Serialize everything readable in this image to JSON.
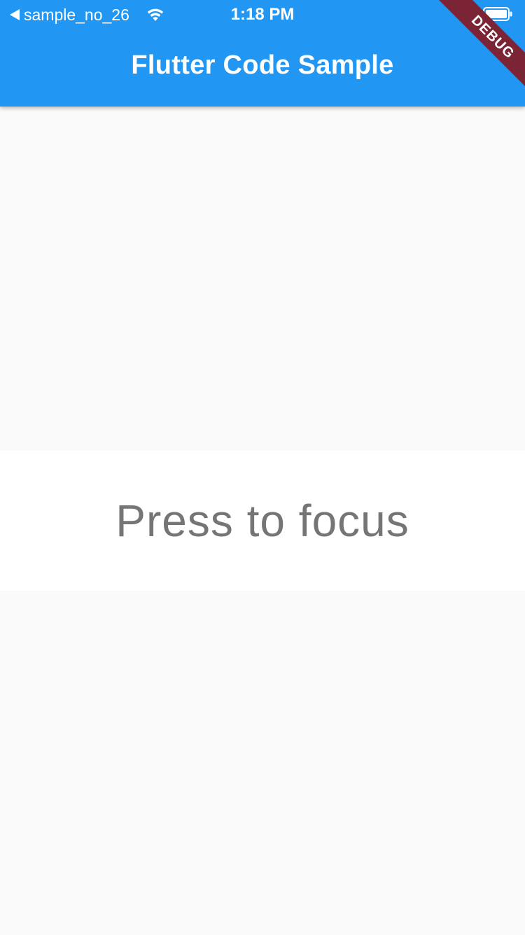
{
  "status_bar": {
    "back_app": "sample_no_26",
    "time": "1:18 PM"
  },
  "app_bar": {
    "title": "Flutter Code Sample",
    "background_color": "#2196f3"
  },
  "debug_banner": {
    "label": "DEBUG",
    "color": "#7a2436"
  },
  "main": {
    "focus_button_label": "Press to focus"
  },
  "icons": {
    "back": "back-arrow-icon",
    "wifi": "wifi-icon",
    "battery": "battery-icon"
  }
}
